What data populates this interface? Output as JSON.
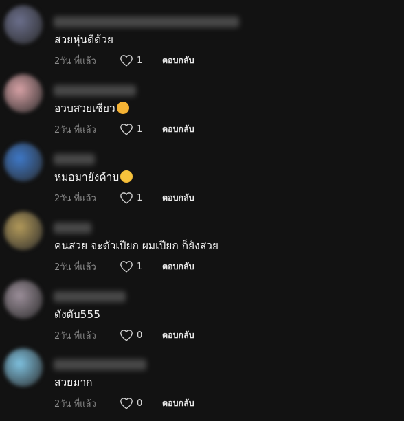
{
  "comments": [
    {
      "text": "สวยหุ่นดีด้วย",
      "time": "2วัน ที่แล้ว",
      "likes": "1",
      "reply": "ตอบกลับ",
      "emoji": null,
      "avatar_color": "#6b6f8c"
    },
    {
      "text": "อวบสวยเชียว",
      "time": "2วัน ที่แล้ว",
      "likes": "1",
      "reply": "ตอบกลับ",
      "emoji": "smiling-face-with-heart-eyes",
      "avatar_color": "#d8a2a6"
    },
    {
      "text": "หมอมายังค้าบ",
      "time": "2วัน ที่แล้ว",
      "likes": "1",
      "reply": "ตอบกลับ",
      "emoji": "tears-of-joy",
      "avatar_color": "#3e79c9"
    },
    {
      "text": "คนสวย จะตัวเปียก ผมเปียก ก็ยังสวย",
      "time": "2วัน ที่แล้ว",
      "likes": "1",
      "reply": "ตอบกลับ",
      "emoji": null,
      "avatar_color": "#b39a5a"
    },
    {
      "text": "ดังตับ555",
      "time": "2วัน ที่แล้ว",
      "likes": "0",
      "reply": "ตอบกลับ",
      "emoji": null,
      "avatar_color": "#9c8f9a"
    },
    {
      "text": "สวยมาก",
      "time": "2วัน ที่แล้ว",
      "likes": "0",
      "reply": "ตอบกลับ",
      "emoji": null,
      "avatar_color": "#7fc2e0"
    }
  ],
  "colors": {
    "background": "#121212",
    "meta_text": "#8a8a8a",
    "username_blur": "#5a5a5a"
  }
}
